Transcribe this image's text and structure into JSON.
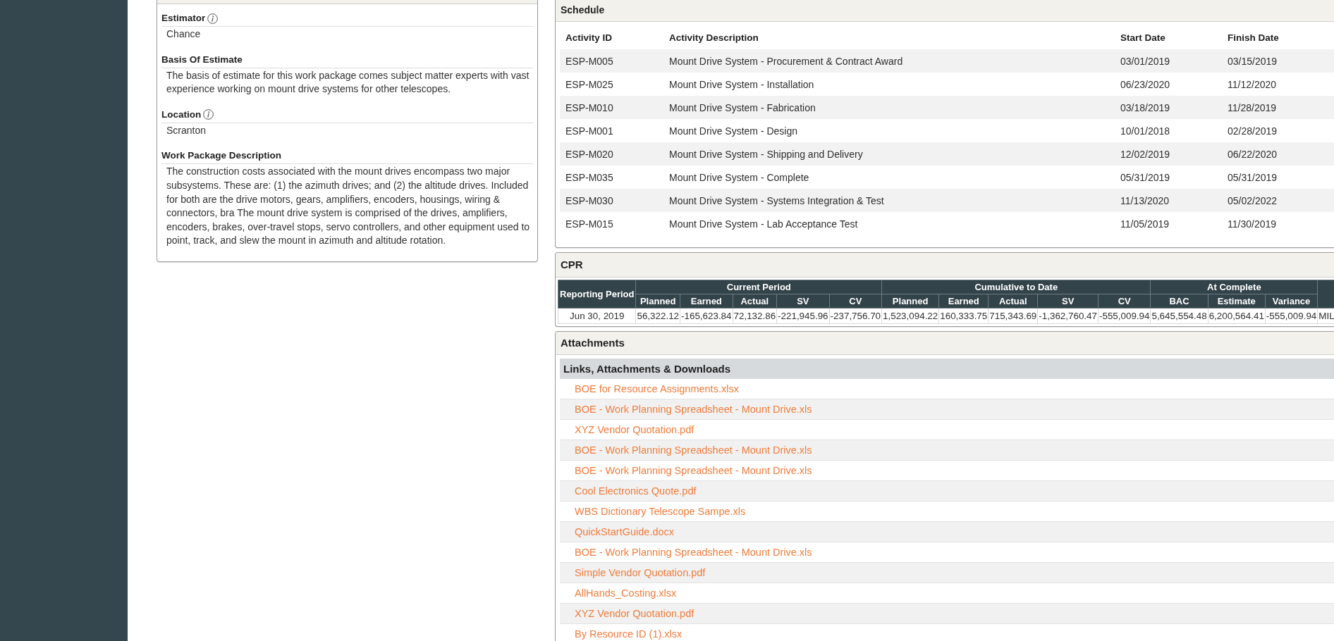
{
  "details_card": {
    "fields": [
      {
        "label": "Estimator",
        "info_icon": true,
        "value": "Chance"
      },
      {
        "label": "Basis Of Estimate",
        "info_icon": false,
        "value": "The basis of estimate for this work package comes subject matter experts with vast experience working on mount drive systems for other telescopes."
      },
      {
        "label": "Location",
        "info_icon": true,
        "value": "Scranton"
      },
      {
        "label": "Work Package Description",
        "info_icon": false,
        "value": "The construction costs associated with the mount drives encompass two major subsystems. These are: (1) the azimuth drives; and (2) the altitude drives. Included for both are the drive motors, gears, amplifiers, encoders, housings, wiring & connectors, bra The mount drive system is comprised of the drives, amplifiers, encoders, brakes, over-travel stops, servo controllers, and other equipment used to point, track, and slew the mount in azimuth and altitude rotation."
      }
    ]
  },
  "schedule": {
    "title": "Schedule",
    "columns": [
      "Activity ID",
      "Activity Description",
      "Start Date",
      "Finish Date"
    ],
    "rows": [
      [
        "ESP-M005",
        "Mount Drive System - Procurement & Contract Award",
        "03/01/2019",
        "03/15/2019"
      ],
      [
        "ESP-M025",
        "Mount Drive System - Installation",
        "06/23/2020",
        "11/12/2020"
      ],
      [
        "ESP-M010",
        "Mount Drive System - Fabrication",
        "03/18/2019",
        "11/28/2019"
      ],
      [
        "ESP-M001",
        "Mount Drive System - Design",
        "10/01/2018",
        "02/28/2019"
      ],
      [
        "ESP-M020",
        "Mount Drive System - Shipping and Delivery",
        "12/02/2019",
        "06/22/2020"
      ],
      [
        "ESP-M035",
        "Mount Drive System - Complete",
        "05/31/2019",
        "05/31/2019"
      ],
      [
        "ESP-M030",
        "Mount Drive System - Systems Integration & Test",
        "11/13/2020",
        "05/02/2022"
      ],
      [
        "ESP-M015",
        "Mount Drive System - Lab Acceptance Test",
        "11/05/2019",
        "11/30/2019"
      ]
    ]
  },
  "cpr": {
    "title": "CPR",
    "row_header": "Reporting Period",
    "groups": [
      {
        "heading": "Current Period",
        "columns": [
          "Planned",
          "Earned",
          "Actual",
          "SV",
          "CV"
        ]
      },
      {
        "heading": "Cumulative to Date",
        "columns": [
          "Planned",
          "Earned",
          "Actual",
          "SV",
          "CV"
        ]
      },
      {
        "heading": "At Complete",
        "columns": [
          "BAC",
          "Estimate",
          "Variance"
        ]
      }
    ],
    "rows": [
      {
        "cells": [
          "Jun 30, 2019",
          "56,322.12",
          "-165,623.84",
          "72,132.86",
          "-221,945.96",
          "-237,756.70",
          "1,523,094.22",
          "160,333.75",
          "715,343.69",
          "-1,362,760.47",
          "-555,009.94",
          "5,645,554.48",
          "6,200,564.41",
          "-555,009.94",
          "MIL"
        ]
      }
    ]
  },
  "attachments": {
    "title": "Attachments",
    "section": "Links, Attachments & Downloads",
    "links": [
      "BOE for Resource Assignments.xlsx",
      "BOE - Work Planning Spreadsheet - Mount Drive.xls",
      "XYZ Vendor Quotation.pdf",
      "BOE - Work Planning Spreadsheet - Mount Drive.xls",
      "BOE - Work Planning Spreadsheet - Mount Drive.xls",
      "Cool Electronics Quote.pdf",
      "WBS Dictionary Telescope Sampe.xls",
      "QuickStartGuide.docx",
      "BOE - Work Planning Spreadsheet - Mount Drive.xls",
      "Simple Vendor Quotation.pdf",
      "AllHands_Costing.xlsx",
      "XYZ Vendor Quotation.pdf",
      "By Resource ID (1).xlsx"
    ]
  }
}
